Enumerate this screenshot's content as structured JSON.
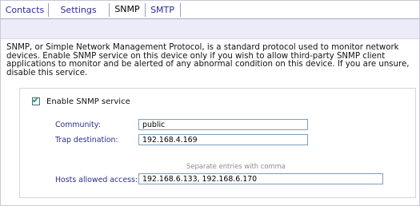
{
  "tabs": [
    {
      "label": "Contacts",
      "active": false
    },
    {
      "label": "Settings",
      "active": false
    },
    {
      "label": "SNMP",
      "active": true
    },
    {
      "label": "SMTP",
      "active": false
    }
  ],
  "description": "SNMP, or Simple Network Management Protocol, is a standard protocol used to monitor network devices. Enable SNMP service on this device only if you wish to allow third-party SNMP client applications to monitor and be alerted of any abnormal condition on this device. If you are unsure, disable this service.",
  "enable_snmp": {
    "label": "Enable SNMP service",
    "checked": true
  },
  "fields": {
    "community": {
      "label": "Community:",
      "value": "public"
    },
    "trap_destination": {
      "label": "Trap destination:",
      "value": "192.168.4.169"
    },
    "hosts_hint": "Separate entries with comma",
    "hosts_allowed": {
      "label": "Hosts allowed access:",
      "value": "192.168.6.133, 192.168.6.170"
    }
  },
  "colors": {
    "tab_link": "#2b2b9a",
    "field_label": "#2b2f8a",
    "banner": "#ecebf8",
    "check": "#23992d"
  }
}
